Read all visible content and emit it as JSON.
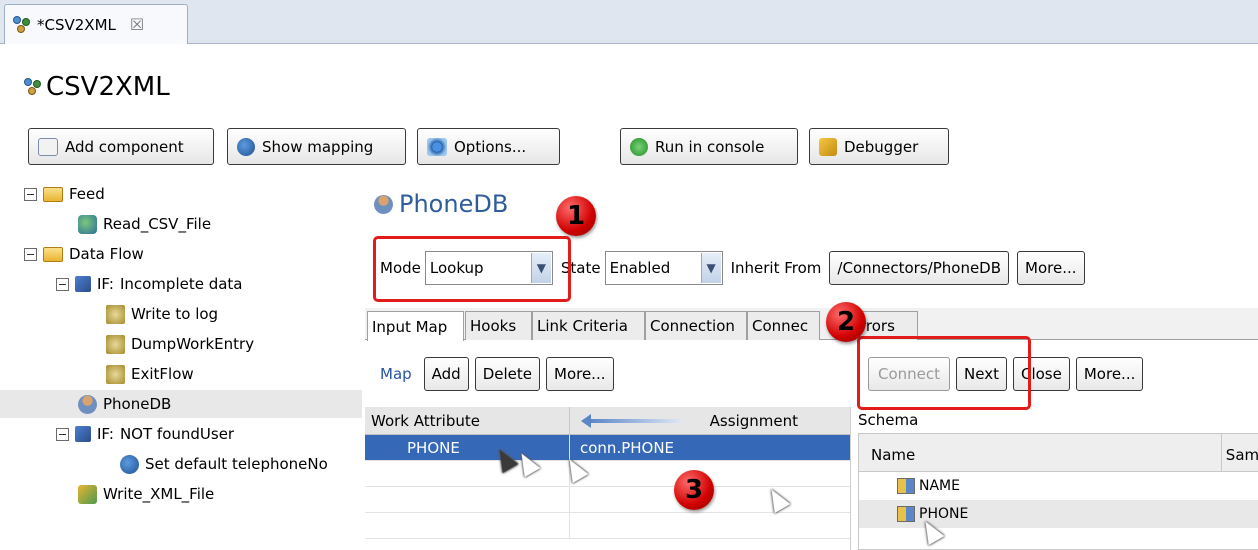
{
  "editor_tab": {
    "label": "*CSV2XML",
    "close": "☒"
  },
  "title": "CSV2XML",
  "toolbar": {
    "add_component": "Add component",
    "show_mapping": "Show mapping",
    "options": "Options...",
    "run_in_console": "Run in console",
    "debugger": "Debugger"
  },
  "tree": {
    "feed": "Feed",
    "read_csv": "Read_CSV_File",
    "data_flow": "Data Flow",
    "if1_prefix": "IF:",
    "if1_label": "Incomplete data",
    "write_to_log": "Write to log",
    "dump_work_entry": "DumpWorkEntry",
    "exit_flow": "ExitFlow",
    "phonedb": "PhoneDB",
    "if2_prefix": "IF:",
    "if2_label": "NOT foundUser",
    "set_default": "Set default telephoneNo",
    "write_xml": "Write_XML_File"
  },
  "connector": {
    "title": "PhoneDB",
    "mode_label": "Mode",
    "mode_value": "Lookup",
    "state_label": "State",
    "state_value": "Enabled",
    "inherit_label": "Inherit From",
    "inherit_value": "/Connectors/PhoneDB",
    "more": "More..."
  },
  "tabs": [
    "Input Map",
    "Hooks",
    "Link Criteria",
    "Connection",
    "Connec",
    "rrors"
  ],
  "map_toolbar": {
    "map": "Map",
    "add": "Add",
    "delete": "Delete",
    "more": "More..."
  },
  "conn_toolbar": {
    "connect": "Connect",
    "next": "Next",
    "close": "Close",
    "more": "More..."
  },
  "map_table": {
    "col_work": "Work Attribute",
    "col_assign": "Assignment",
    "rows": [
      {
        "work": "PHONE",
        "assign": "conn.PHONE"
      }
    ]
  },
  "schema": {
    "label": "Schema",
    "col_name": "Name",
    "col_sample": "Sam",
    "rows": [
      "NAME",
      "PHONE"
    ]
  },
  "callouts": [
    "1",
    "2",
    "3"
  ],
  "colors": {
    "callout_red": "#e21b1b",
    "selection_blue": "#3668b8",
    "title_blue": "#2f5c9b"
  }
}
